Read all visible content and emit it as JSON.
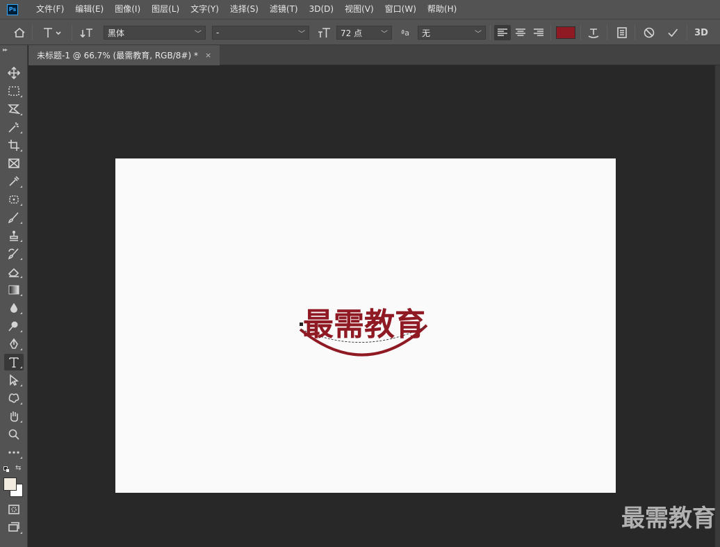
{
  "app": {
    "logo_text": "Ps"
  },
  "menu": [
    "文件(F)",
    "编辑(E)",
    "图像(I)",
    "图层(L)",
    "文字(Y)",
    "选择(S)",
    "滤镜(T)",
    "3D(D)",
    "视图(V)",
    "窗口(W)",
    "帮助(H)"
  ],
  "options": {
    "font_family": "黑体",
    "font_style": "-",
    "font_size": "72 点",
    "anti_alias_label": "ªa",
    "anti_alias": "无",
    "three_d_label": "3D",
    "text_color": "#8f1a24"
  },
  "document": {
    "tab_title": "未标题-1 @ 66.7% (最需教育, RGB/8#) *",
    "close_glyph": "×",
    "canvas_text": "最需教育",
    "text_color": "#8f1a24"
  },
  "watermark": "最需教育",
  "tools": [
    "move-tool",
    "marquee-tool",
    "lasso-tool",
    "magic-wand-tool",
    "crop-tool",
    "frame-tool",
    "eyedropper-tool",
    "spot-healing-tool",
    "brush-tool",
    "clone-stamp-tool",
    "history-brush-tool",
    "eraser-tool",
    "gradient-tool",
    "blur-tool",
    "dodge-tool",
    "pen-tool",
    "type-tool",
    "path-selection-tool",
    "custom-shape-tool",
    "hand-tool",
    "zoom-tool",
    "more-tools"
  ],
  "colors": {
    "foreground": "#f2ece0",
    "background": "#ffffff"
  }
}
